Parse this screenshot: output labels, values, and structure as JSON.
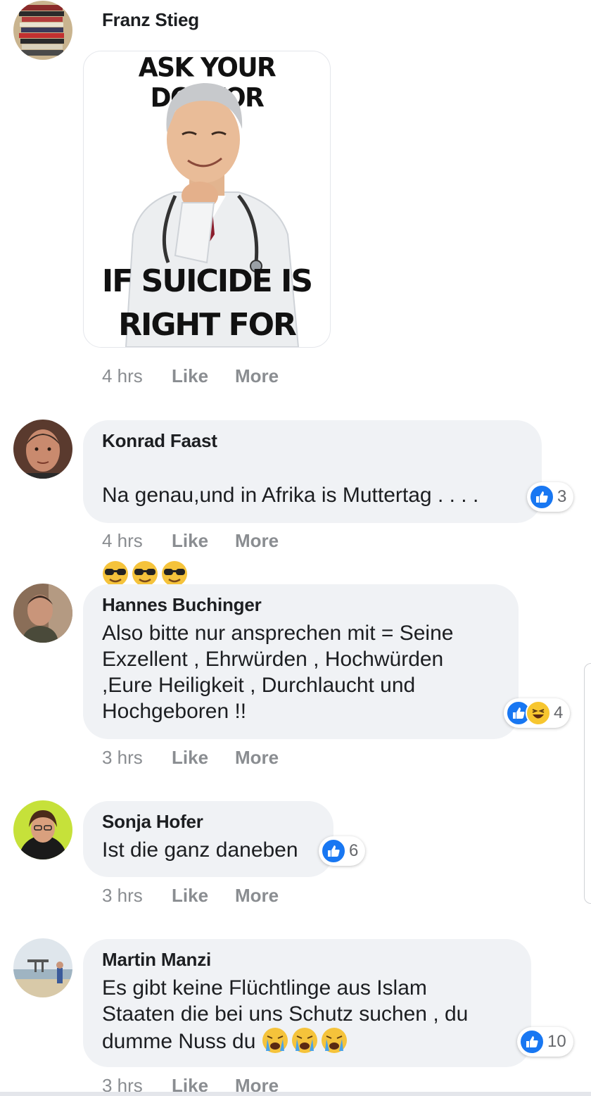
{
  "comments": [
    {
      "author": "Franz Stieg",
      "meme": {
        "top_text": "ASK YOUR DOCTOR",
        "bottom_line1": "IF SUICIDE IS",
        "bottom_line2": "RIGHT FOR YOU"
      },
      "time": "4 hrs",
      "like": "Like",
      "more": "More"
    },
    {
      "author": "Konrad Faast",
      "text": "Na genau,und in Afrika is Muttertag . . . .",
      "emoji": "sunglasses-emoji",
      "reactions": {
        "types": [
          "like"
        ],
        "count": "3"
      },
      "time": "4 hrs",
      "like": "Like",
      "more": "More"
    },
    {
      "author": "Hannes Buchinger",
      "text": "Also bitte nur ansprechen mit = Seine\nExzellent , Ehrwürden , Hochwürden\n,Eure Heiligkeit , Durchlaucht und\nHochgeboren !!",
      "reactions": {
        "types": [
          "like",
          "haha"
        ],
        "count": "4"
      },
      "time": "3 hrs",
      "like": "Like",
      "more": "More"
    },
    {
      "author": "Sonja Hofer",
      "text": "Ist die ganz daneben",
      "reactions": {
        "types": [
          "like"
        ],
        "count": "6"
      },
      "time": "3 hrs",
      "like": "Like",
      "more": "More"
    },
    {
      "author": "Martin Manzi",
      "text": "Es gibt keine Flüchtlinge aus Islam\nStaaten die bei uns Schutz suchen , du\ndumme Nuss du",
      "emoji": "crying-emoji",
      "reactions": {
        "types": [
          "like"
        ],
        "count": "10"
      },
      "time": "3 hrs",
      "like": "Like",
      "more": "More"
    }
  ],
  "colors": {
    "like_blue": "#1877f2",
    "bubble_bg": "#f0f2f5",
    "meta_gray": "#8a8d91"
  }
}
